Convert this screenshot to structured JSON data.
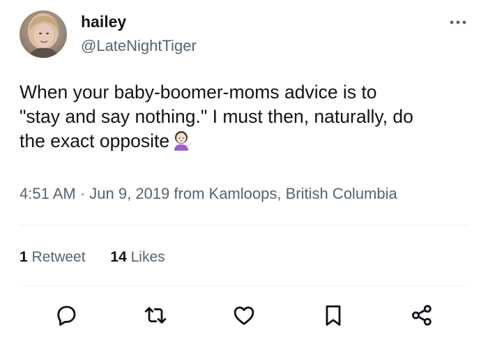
{
  "user": {
    "display_name": "hailey",
    "handle": "@LateNightTiger",
    "avatar_icon": "avatar-photo"
  },
  "more_icon": "more-horizontal-icon",
  "tweet": {
    "lines": [
      "When your baby-boomer-moms advice is to",
      "\"stay and say nothing.\" I must then, naturally, do",
      "the exact opposite"
    ],
    "emoji": "woman-tipping-hand"
  },
  "meta": {
    "time": "4:51 AM",
    "separator": "·",
    "date": "Jun 9, 2019",
    "location": "from Kamloops, British Columbia"
  },
  "stats": {
    "retweets_count": "1",
    "retweets_label": "Retweet",
    "likes_count": "14",
    "likes_label": "Likes"
  },
  "actions": [
    {
      "icon": "reply-icon"
    },
    {
      "icon": "retweet-icon"
    },
    {
      "icon": "like-heart-icon"
    },
    {
      "icon": "bookmark-icon"
    },
    {
      "icon": "share-icon"
    }
  ],
  "colors": {
    "text": "#0f1419",
    "secondary": "#536471",
    "divider": "#eff3f4"
  }
}
